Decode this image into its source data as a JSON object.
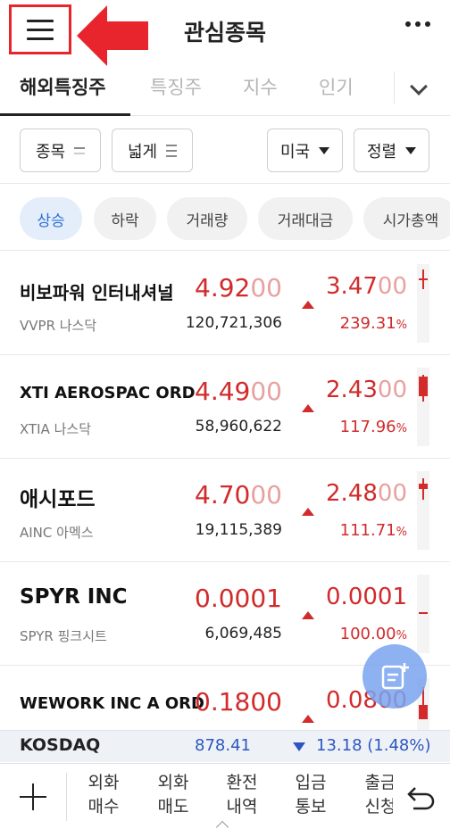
{
  "header": {
    "title": "관심종목",
    "menu_icon": "hamburger-icon",
    "more_icon": "more-horizontal-icon",
    "highlight_color": "#e8242c"
  },
  "tabs": [
    {
      "label": "해외특징주",
      "active": true
    },
    {
      "label": "특징주",
      "active": false
    },
    {
      "label": "지수",
      "active": false
    },
    {
      "label": "인기",
      "active": false
    }
  ],
  "filters": {
    "item": "종목",
    "width": "넓게",
    "market": "미국",
    "sort": "정렬"
  },
  "chips": [
    {
      "label": "상승",
      "active": true
    },
    {
      "label": "하락",
      "active": false
    },
    {
      "label": "거래량",
      "active": false
    },
    {
      "label": "거래대금",
      "active": false
    },
    {
      "label": "시가총액",
      "active": false
    }
  ],
  "stocks": [
    {
      "name": "비보파워 인터내셔널",
      "ticker_market": "VVPR 나스닥",
      "price_main": "4.92",
      "price_tail": "00",
      "volume": "120,721,306",
      "change_main": "3.47",
      "change_tail": "00",
      "percent": "239.31",
      "pct_unit": "%"
    },
    {
      "name": "XTI AEROSPAC ORD",
      "ticker_market": "XTIA 나스닥",
      "price_main": "4.49",
      "price_tail": "00",
      "volume": "58,960,622",
      "change_main": "2.43",
      "change_tail": "00",
      "percent": "117.96",
      "pct_unit": "%"
    },
    {
      "name": "애시포드",
      "ticker_market": "AINC 아멕스",
      "price_main": "4.70",
      "price_tail": "00",
      "volume": "19,115,389",
      "change_main": "2.48",
      "change_tail": "00",
      "percent": "111.71",
      "pct_unit": "%"
    },
    {
      "name": "SPYR INC",
      "ticker_market": "SPYR 핑크시트",
      "price_main": "0.0001",
      "price_tail": "",
      "volume": "6,069,485",
      "change_main": "0.0001",
      "change_tail": "",
      "percent": "100.00",
      "pct_unit": "%"
    },
    {
      "name": "WEWORK INC A ORD",
      "ticker_market": "",
      "price_main": "0.1800",
      "price_tail": "",
      "volume": "",
      "change_main": "0.0800",
      "change_tail": "",
      "percent": "",
      "pct_unit": ""
    }
  ],
  "index_bar": {
    "name": "KOSDAQ",
    "value": "878.41",
    "change": "13.18 (1.48%)",
    "direction": "down",
    "color": "#2d56c2"
  },
  "bottom_nav": [
    {
      "line1": "외화",
      "line2": "매수"
    },
    {
      "line1": "외화",
      "line2": "매도"
    },
    {
      "line1": "환전",
      "line2": "내역"
    },
    {
      "line1": "입금",
      "line2": "통보"
    },
    {
      "line1": "출금",
      "line2": "신청"
    }
  ],
  "colors": {
    "up": "#d12b2b",
    "down": "#2d56c2",
    "chip_active_bg": "#e4eefb",
    "chip_active_text": "#2d6fd6"
  }
}
